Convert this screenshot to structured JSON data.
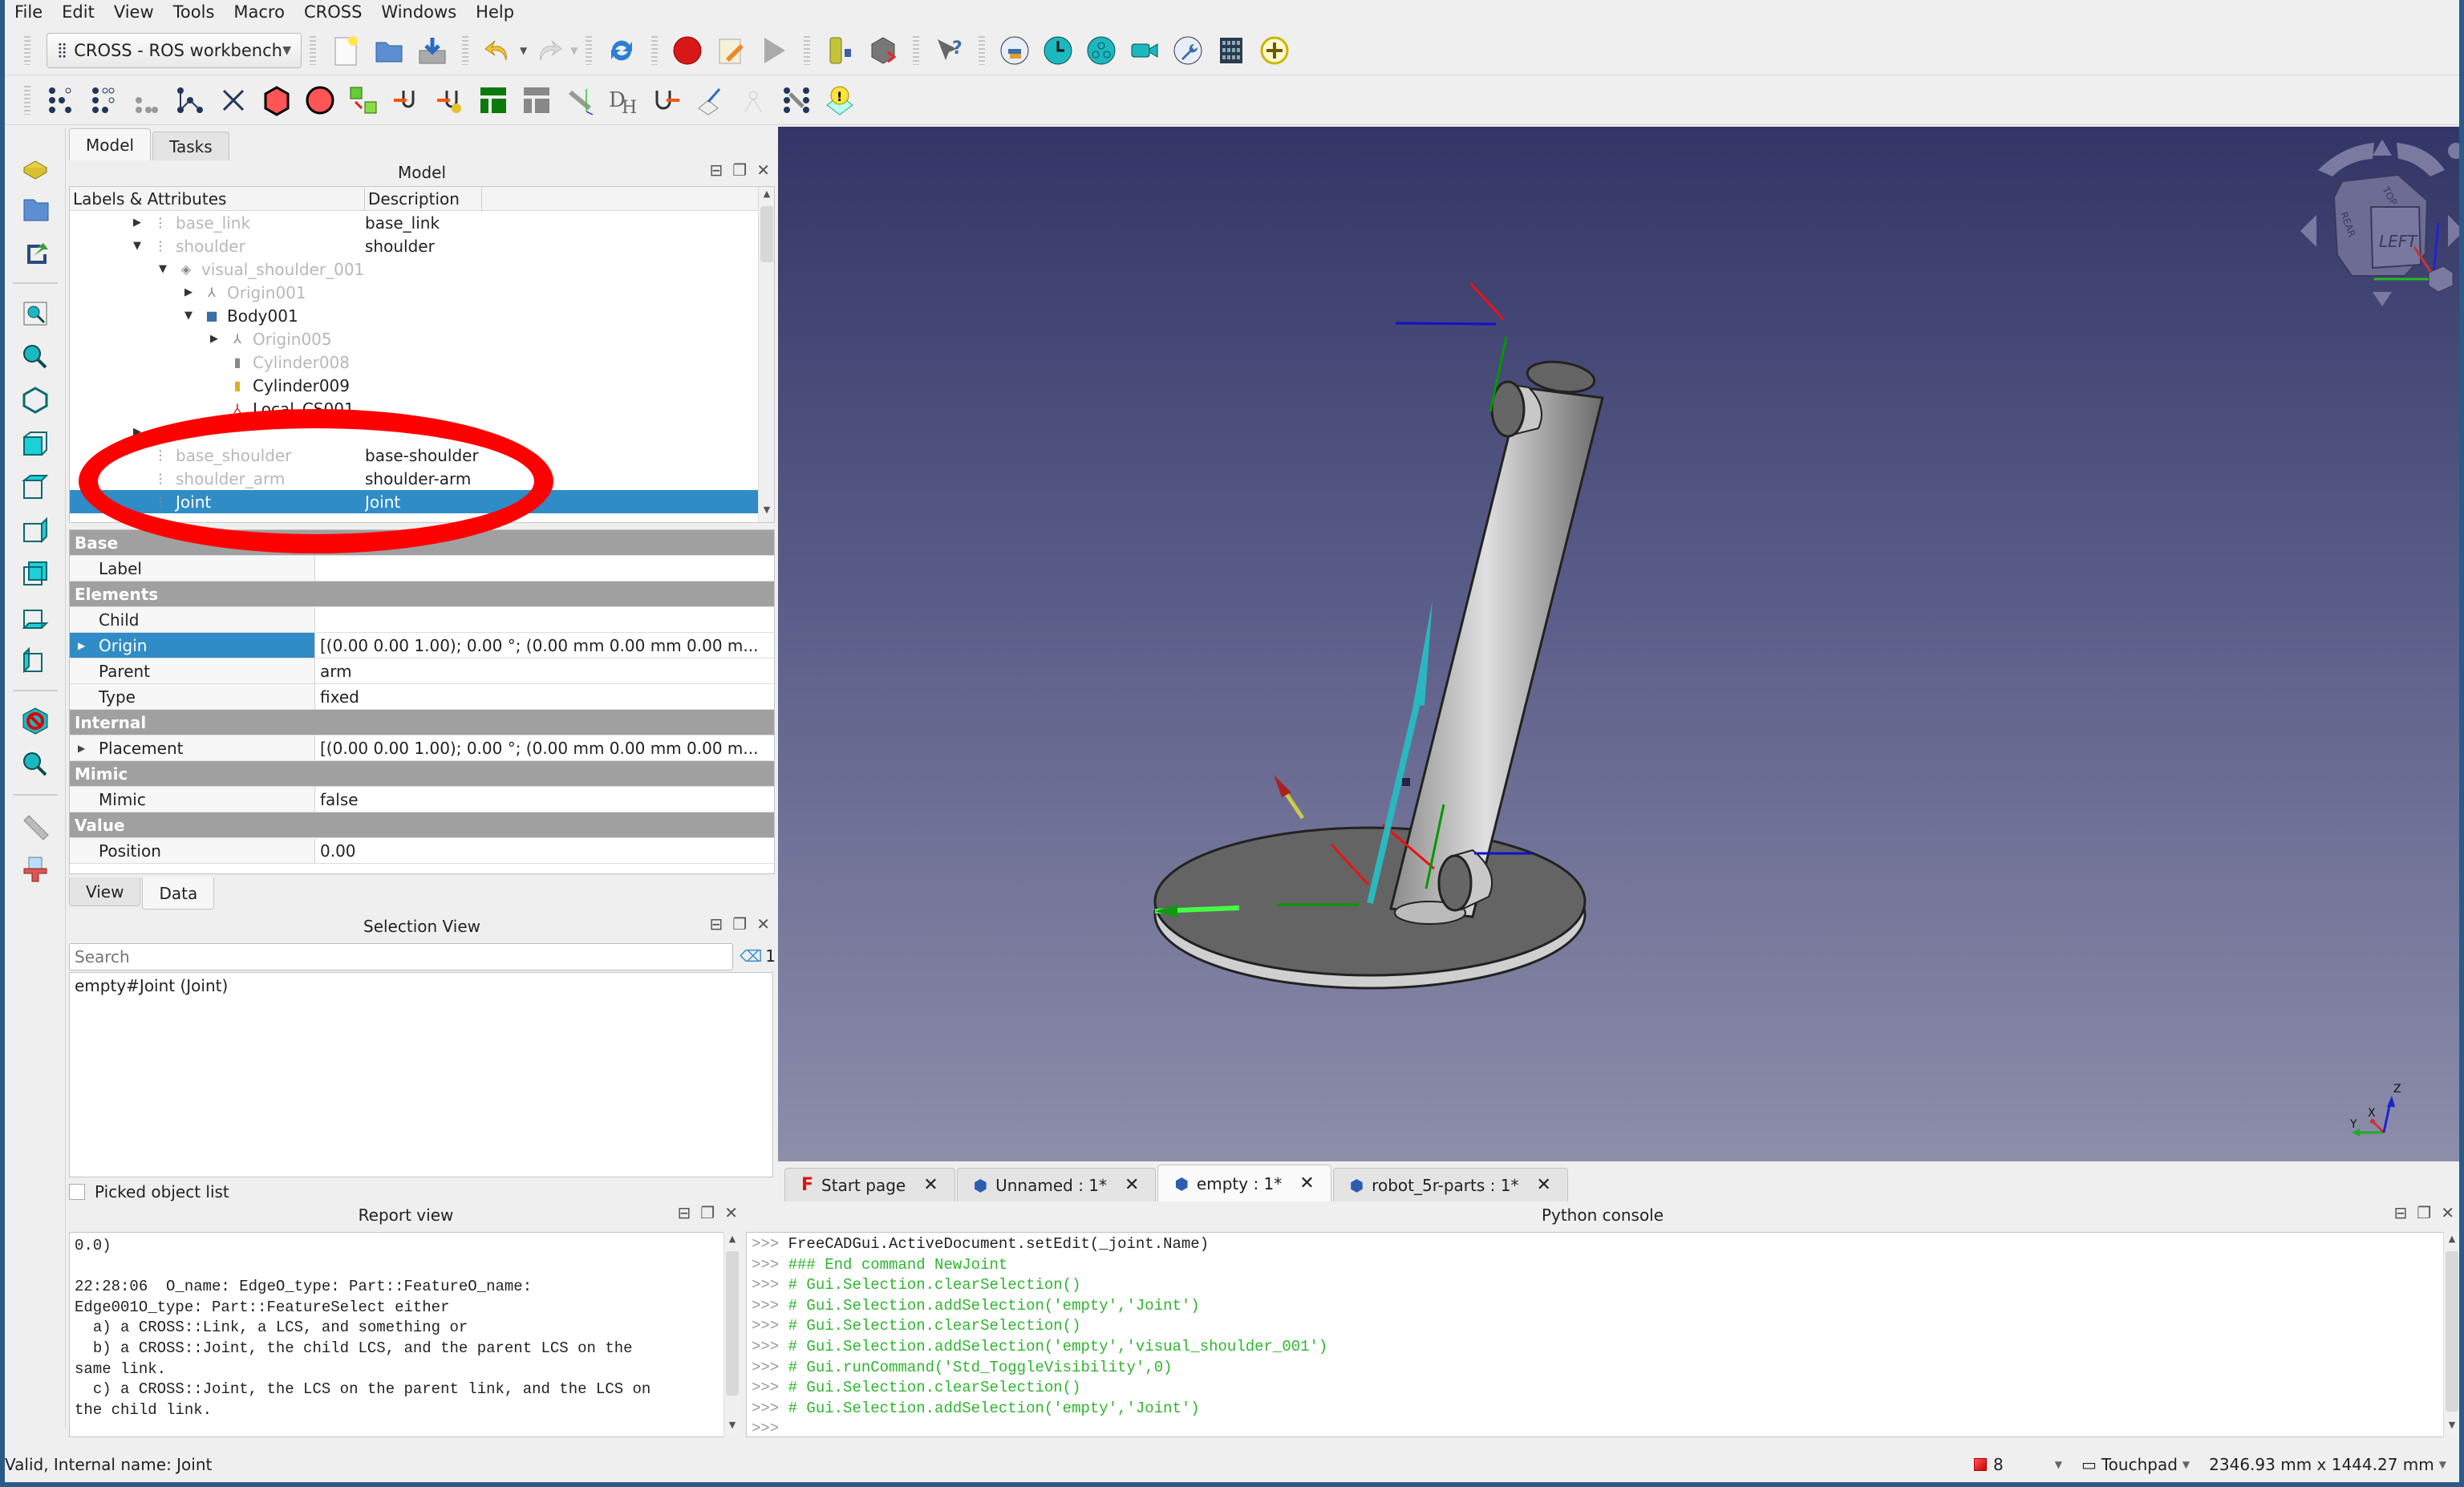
{
  "menubar": [
    "File",
    "Edit",
    "View",
    "Tools",
    "Macro",
    "CROSS",
    "Windows",
    "Help"
  ],
  "toolbar": {
    "workbench": "CROSS - ROS workbench",
    "main_icons": [
      "new-document-icon",
      "open-folder-icon",
      "save-icon",
      "undo-icon",
      "redo-icon",
      "refresh-icon",
      "macro-record-icon",
      "macro-edit-icon",
      "macro-run-icon",
      "robot-icon",
      "send-to-cube-icon",
      "whats-this-icon",
      "python-icon",
      "clock-icon",
      "network-icon",
      "camera-icon",
      "wrench-icon",
      "grid-icon",
      "add-icon"
    ],
    "cross_icons": [
      "new-robot-icon",
      "new-link-icon",
      "new-link-dim-icon",
      "new-joint-icon",
      "new-chain-icon",
      "box-icon",
      "sphere-icon",
      "set-placement-icon",
      "set-joint-icon",
      "set-joint-yellow-icon",
      "bar-chart-icon",
      "bar-chart-gray-icon",
      "axes-icon",
      "dh-icon",
      "u-arrow-icon",
      "pose-icon",
      "wizard-icon",
      "grid-dots-icon",
      "warning-bulb-icon"
    ]
  },
  "left_toolbar": [
    "part-icon",
    "folder-icon",
    "export-icon",
    "fit-all-icon",
    "fit-selection-icon",
    "isometric-icon",
    "front-view-icon",
    "top-view-icon",
    "right-view-icon",
    "rear-view-icon",
    "bottom-view-icon",
    "left-view-icon",
    "draw-style-icon",
    "sync-view-icon",
    "measure-icon",
    "std-part-icon"
  ],
  "combo": {
    "tabs": [
      "Model",
      "Tasks"
    ],
    "active_tab": "Model",
    "model_title": "Model",
    "tree_headers": [
      "Labels & Attributes",
      "Description"
    ],
    "tree": [
      {
        "label": "base_link",
        "desc": "base_link",
        "indent": 0,
        "arrow": "right",
        "dim": true
      },
      {
        "label": "shoulder",
        "desc": "shoulder",
        "indent": 0,
        "arrow": "down",
        "dim": true
      },
      {
        "label": "visual_shoulder_001",
        "desc": "",
        "indent": 1,
        "arrow": "down",
        "dim": true
      },
      {
        "label": "Origin001",
        "desc": "",
        "indent": 2,
        "arrow": "right",
        "dim": true
      },
      {
        "label": "Body001",
        "desc": "",
        "indent": 2,
        "arrow": "down",
        "dim": false
      },
      {
        "label": "Origin005",
        "desc": "",
        "indent": 3,
        "arrow": "right",
        "dim": true
      },
      {
        "label": "Cylinder008",
        "desc": "",
        "indent": 3,
        "arrow": "",
        "dim": true
      },
      {
        "label": "Cylinder009",
        "desc": "",
        "indent": 3,
        "arrow": "",
        "dim": false
      },
      {
        "label": "Local_CS001",
        "desc": "",
        "indent": 3,
        "arrow": "",
        "dim": false
      },
      {
        "label": "",
        "desc": "",
        "indent": 0,
        "arrow": "right",
        "dim": true
      },
      {
        "label": "base_shoulder",
        "desc": "base-shoulder",
        "indent": 0,
        "arrow": "",
        "dim": true
      },
      {
        "label": "shoulder_arm",
        "desc": "shoulder-arm",
        "indent": 0,
        "arrow": "",
        "dim": true
      },
      {
        "label": "Joint",
        "desc": "Joint",
        "indent": 0,
        "arrow": "",
        "dim": false,
        "selected": true
      }
    ],
    "properties": [
      {
        "group": "Base"
      },
      {
        "name": "Label",
        "value": ""
      },
      {
        "group": "Elements"
      },
      {
        "name": "Child",
        "value": ""
      },
      {
        "name": "Origin",
        "value": "[(0.00 0.00 1.00); 0.00 °; (0.00 mm  0.00 mm  0.00 m...",
        "expandable": true,
        "selected": true
      },
      {
        "name": "Parent",
        "value": "arm"
      },
      {
        "name": "Type",
        "value": "fixed"
      },
      {
        "group": "Internal"
      },
      {
        "name": "Placement",
        "value": "[(0.00 0.00 1.00); 0.00 °; (0.00 mm  0.00 mm  0.00 m...",
        "expandable": true
      },
      {
        "group": "Mimic"
      },
      {
        "name": "Mimic",
        "value": "false"
      },
      {
        "group": "Value"
      },
      {
        "name": "Position",
        "value": "0.00"
      }
    ],
    "prop_tabs": [
      "View",
      "Data"
    ],
    "active_prop_tab": "Data"
  },
  "selection_view": {
    "title": "Selection View",
    "search_placeholder": "Search",
    "count": "1",
    "items": [
      "empty#Joint (Joint)"
    ],
    "picked_label": "Picked object list"
  },
  "view3d": {
    "navcube_face": "LEFT",
    "navcube_top": "TOP",
    "navcube_rear": "REAR",
    "axis_labels": [
      "X",
      "Y",
      "Z"
    ]
  },
  "doc_tabs": [
    {
      "label": "Start page",
      "icon": "freecad-start-icon"
    },
    {
      "label": "Unnamed : 1*",
      "icon": "document-icon"
    },
    {
      "label": "empty : 1*",
      "icon": "document-icon",
      "active": true
    },
    {
      "label": "robot_5r-parts : 1*",
      "icon": "document-icon"
    }
  ],
  "report_view": {
    "title": "Report view",
    "text": "0.0)\n\n22:28:06  O_name: EdgeO_type: Part::FeatureO_name:\nEdge001O_type: Part::FeatureSelect either\n  a) a CROSS::Link, a LCS, and something or\n  b) a CROSS::Joint, the child LCS, and the parent LCS on the\nsame link.\n  c) a CROSS::Joint, the LCS on the parent link, and the LCS on\nthe child link."
  },
  "python_console": {
    "title": "Python console",
    "lines": [
      {
        "text": "FreeCADGui.ActiveDocument.setEdit(_joint.Name)",
        "kind": "cmd"
      },
      {
        "text": "### End command NewJoint",
        "kind": "comment"
      },
      {
        "text": "# Gui.Selection.clearSelection()",
        "kind": "comment"
      },
      {
        "text": "# Gui.Selection.addSelection('empty','Joint')",
        "kind": "comment"
      },
      {
        "text": "# Gui.Selection.clearSelection()",
        "kind": "comment"
      },
      {
        "text": "# Gui.Selection.addSelection('empty','visual_shoulder_001')",
        "kind": "comment"
      },
      {
        "text": "# Gui.runCommand('Std_ToggleVisibility',0)",
        "kind": "comment"
      },
      {
        "text": "# Gui.Selection.clearSelection()",
        "kind": "comment"
      },
      {
        "text": "# Gui.Selection.addSelection('empty','Joint')",
        "kind": "comment"
      },
      {
        "text": "",
        "kind": "cmd"
      }
    ],
    "prompt": ">>>"
  },
  "statusbar": {
    "message": "Valid, Internal name: Joint",
    "error_count": "8",
    "navigation": "Touchpad",
    "dimensions": "2346.93 mm x 1444.27 mm"
  },
  "colors": {
    "selection": "#308cc6",
    "annotation": "#ff0000",
    "console_comment": "#2fb52f"
  }
}
